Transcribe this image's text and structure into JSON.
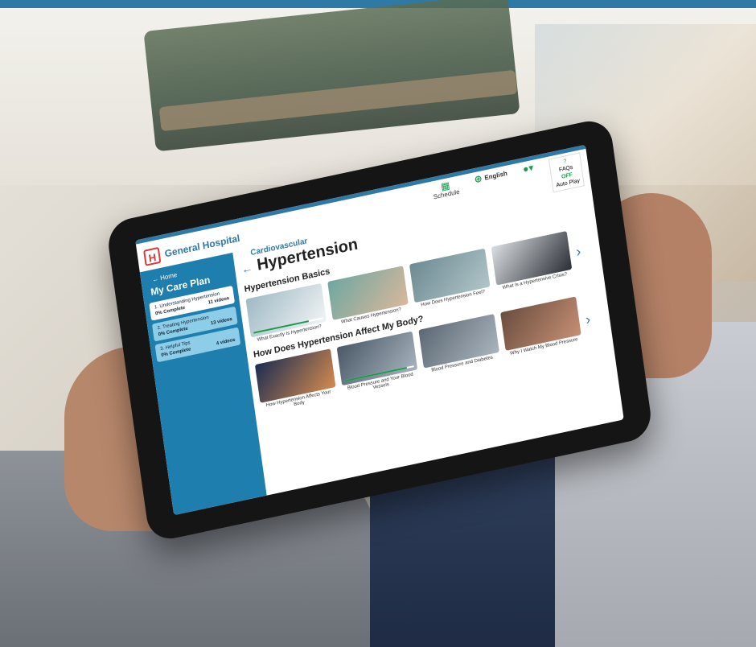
{
  "app": {
    "logo_letter": "H",
    "hospital_name": "General Hospital"
  },
  "top_nav": {
    "schedule_label": "Schedule",
    "language_label": "English",
    "faqs_label": "FAQs",
    "autoplay_state": "OFF",
    "autoplay_label": "Auto Play"
  },
  "sidebar": {
    "home_label": "← Home",
    "title": "My Care Plan",
    "items": [
      {
        "label": "1. Understanding Hypertension",
        "progress": "0% Complete",
        "videos": "11 videos"
      },
      {
        "label": "2. Treating Hypertension",
        "progress": "0% Complete",
        "videos": "13 videos"
      },
      {
        "label": "3. Helpful Tips",
        "progress": "0% Complete",
        "videos": "4 videos"
      }
    ]
  },
  "main": {
    "breadcrumb": "Cardiovascular",
    "title": "Hypertension",
    "sections": [
      {
        "title": "Hypertension Basics",
        "videos": [
          {
            "caption": "What Exactly Is Hypertension?",
            "progress": 0.8
          },
          {
            "caption": "What Causes Hypertension?",
            "progress": 0
          },
          {
            "caption": "How Does Hypertension Feel?",
            "progress": 0
          },
          {
            "caption": "What Is a Hypertensive Crisis?",
            "progress": 0
          }
        ]
      },
      {
        "title": "How Does Hypertension Affect My Body?",
        "videos": [
          {
            "caption": "How Hypertension Affects Your Body",
            "progress": 0
          },
          {
            "caption": "Blood Pressure and Your Blood Vessels",
            "progress": 0.9
          },
          {
            "caption": "Blood Pressure and Diabetes",
            "progress": 0
          },
          {
            "caption": "Why I Watch My Blood Pressure",
            "progress": 0
          }
        ]
      }
    ]
  },
  "colors": {
    "brand_blue": "#2f79a6",
    "sidebar_blue": "#1e7fae",
    "accent_green": "#1a9a4c",
    "logo_red": "#d63a3a"
  }
}
